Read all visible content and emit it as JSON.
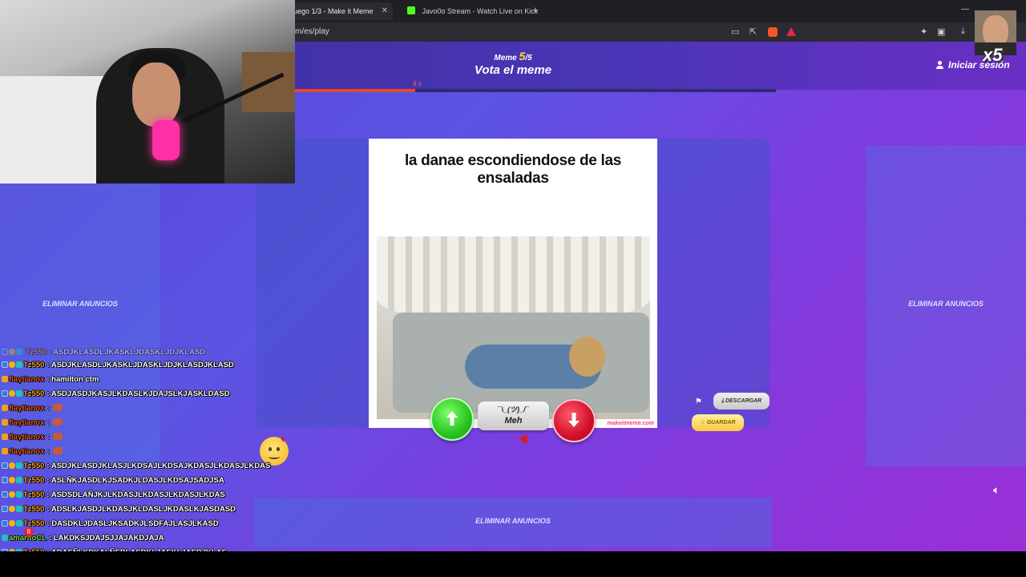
{
  "browser": {
    "tabs": [
      {
        "label": "uego 1/3 - Make it Meme",
        "active": true
      },
      {
        "label": "Javo0o Stream - Watch Live on Kick",
        "active": false
      }
    ],
    "tab_close": "✕",
    "new_tab": "+",
    "url": "m/es/play",
    "window_controls": [
      "—",
      "❐",
      "✕"
    ]
  },
  "site": {
    "meme_label": "Meme",
    "meme_current": "5",
    "meme_total": "/5",
    "title": "Vota el meme",
    "login_label": "Iniciar sesión",
    "timer_label": "6 s",
    "timer_progress": 0.25,
    "ad_label": "ELIMINAR ANUNCIOS",
    "meme": {
      "caption": "la danae escondiendose de las ensaladas",
      "watermark": "makeitmeme.com"
    },
    "vote": {
      "meh_face": "¯\\_(ツ)_/¯",
      "meh_label": "Meh"
    },
    "download_label": "DESCARGAR",
    "save_label": "GUARDAR"
  },
  "overlay": {
    "cam_multiplier": "x5",
    "notification_count": "8",
    "chat": [
      {
        "user": "Tz550",
        "text": ": ASDJKLASDLJKASKLJDASKLJDJKLASDJKLASD",
        "color": "orange",
        "badges": [
          "blue",
          "gold",
          "teal"
        ],
        "emote_count": 0
      },
      {
        "user": "flaytianox",
        "text": ": hamilton ctm",
        "color": "red",
        "badges": [
          "crown"
        ],
        "emote_count": 0
      },
      {
        "user": "Tz550",
        "text": ": ASDJASDJKASJLKDASLKJDAJSLKJASKLDASD",
        "color": "orange",
        "badges": [
          "blue",
          "gold",
          "teal"
        ],
        "emote_count": 0
      },
      {
        "user": "flaytianox",
        "text": ":",
        "color": "red",
        "badges": [
          "crown"
        ],
        "emote_count": 1
      },
      {
        "user": "flaytianox",
        "text": ":",
        "color": "red",
        "badges": [
          "crown"
        ],
        "emote_count": 1
      },
      {
        "user": "flaytianox",
        "text": ":",
        "color": "red",
        "badges": [
          "crown"
        ],
        "emote_count": 1
      },
      {
        "user": "flaytianox",
        "text": ":",
        "color": "red",
        "badges": [
          "crown"
        ],
        "emote_count": 1
      },
      {
        "user": "Tz550",
        "text": ": ASDJKLASDJKLASJLKDSAJLKDSAJKDASJLKDASJLKDAS",
        "color": "orange",
        "badges": [
          "blue",
          "gold",
          "teal"
        ],
        "emote_count": 0
      },
      {
        "user": "Tz550",
        "text": ": ASLÑKJASDLKJSADKJLDASJLKDSAJSADJSA",
        "color": "orange",
        "badges": [
          "blue",
          "gold",
          "teal"
        ],
        "emote_count": 0
      },
      {
        "user": "Tz550",
        "text": ": ASDSDLAÑJKJLKDASJLKDASJLKDASJLKDAS",
        "color": "orange",
        "badges": [
          "blue",
          "gold",
          "teal"
        ],
        "emote_count": 0
      },
      {
        "user": "Tz550",
        "text": ": ADSLKJASDJLKDASJKLDASLJKDASLKJASDASD",
        "color": "orange",
        "badges": [
          "blue",
          "gold",
          "teal"
        ],
        "emote_count": 0
      },
      {
        "user": "Tz550",
        "text": ": DASDKLJDASLJKSADKJLSDFAJLASJLKASD",
        "color": "orange",
        "badges": [
          "blue",
          "gold",
          "teal"
        ],
        "emote_count": 0
      },
      {
        "user": "amaritoCL",
        "text": ": LAKDKSJDAJSJJAJAKDJAJA",
        "color": "green",
        "badges": [
          "teal"
        ],
        "emote_count": 0
      },
      {
        "user": "Tz550",
        "text": ": ADASÑLKDKALÑSDLASDKLJASKLJASDJKLAS",
        "color": "orange",
        "badges": [
          "blue",
          "gold",
          "teal"
        ],
        "emote_count": 0
      }
    ]
  }
}
